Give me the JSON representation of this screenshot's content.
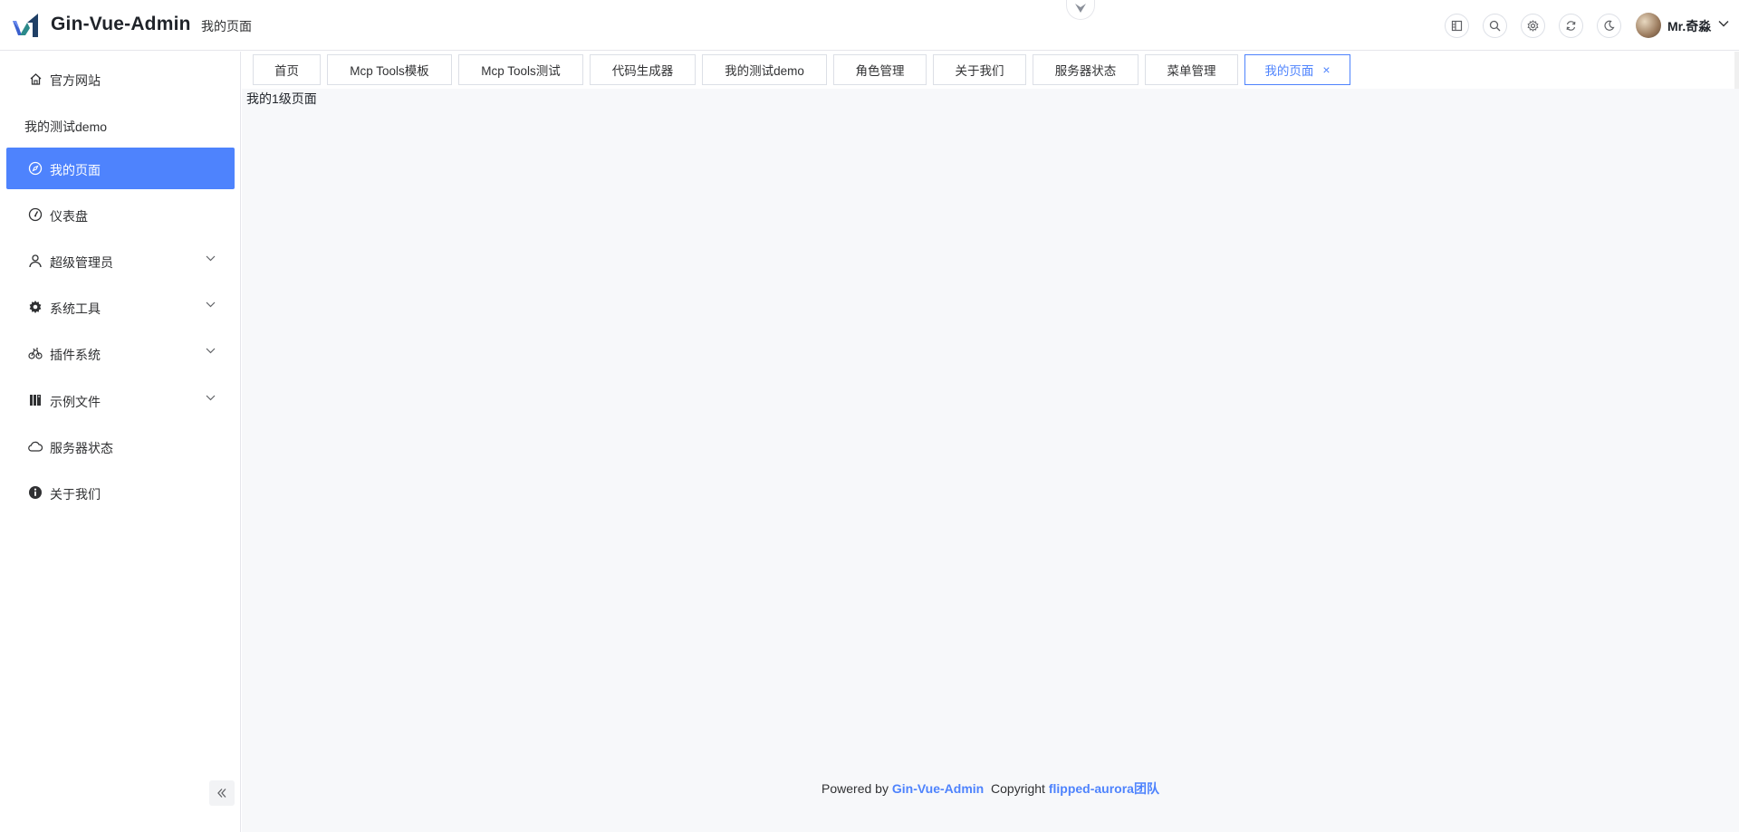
{
  "header": {
    "brand": "Gin-Vue-Admin",
    "breadcrumb": "我的页面",
    "username": "Mr.奇淼",
    "icons": [
      "layout-icon",
      "search-icon",
      "gear-icon",
      "refresh-icon",
      "moon-icon"
    ]
  },
  "sidebar": {
    "items": [
      {
        "label": "官方网站",
        "icon": "home-icon"
      },
      {
        "label": "我的测试demo",
        "icon": ""
      },
      {
        "label": "我的页面",
        "icon": "compass-icon",
        "active": true
      },
      {
        "label": "仪表盘",
        "icon": "gauge-icon"
      },
      {
        "label": "超级管理员",
        "icon": "user-icon",
        "expandable": true
      },
      {
        "label": "系统工具",
        "icon": "cog-icon",
        "expandable": true
      },
      {
        "label": "插件系统",
        "icon": "bicycle-icon",
        "expandable": true
      },
      {
        "label": "示例文件",
        "icon": "book-icon",
        "expandable": true
      },
      {
        "label": "服务器状态",
        "icon": "cloud-icon"
      },
      {
        "label": "关于我们",
        "icon": "info-icon"
      }
    ]
  },
  "tabs": [
    {
      "label": "首页"
    },
    {
      "label": "Mcp Tools模板"
    },
    {
      "label": "Mcp Tools测试"
    },
    {
      "label": "代码生成器"
    },
    {
      "label": "我的测试demo"
    },
    {
      "label": "角色管理"
    },
    {
      "label": "关于我们"
    },
    {
      "label": "服务器状态"
    },
    {
      "label": "菜单管理"
    },
    {
      "label": "我的页面",
      "active": true,
      "closable": true
    }
  ],
  "content": {
    "text": "我的1级页面"
  },
  "footer": {
    "powered_by": "Powered by",
    "brand_link": "Gin-Vue-Admin",
    "copyright": "Copyright",
    "team_link": "flipped-aurora团队"
  },
  "colors": {
    "accent": "#4e83fd",
    "content_bg": "#f7f8fa",
    "border": "#e5e6eb"
  }
}
